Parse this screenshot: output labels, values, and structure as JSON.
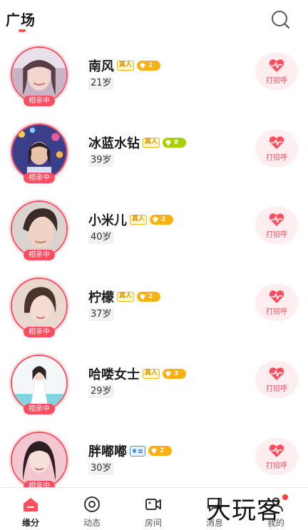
{
  "header": {
    "title": "广场",
    "search_icon": "search-icon"
  },
  "colors": {
    "accent": "#ff4d5e",
    "real_badge": "#f5b800",
    "level_orange": "#f9b111",
    "level_green": "#a6d300"
  },
  "users": [
    {
      "name": "南风",
      "age": "21岁",
      "status": "相亲中",
      "badge": "真人",
      "level": "2",
      "level_color": "orange",
      "greet_label": "打招呼"
    },
    {
      "name": "冰蓝水钻",
      "age": "39岁",
      "status": "相亲中",
      "badge": "真人",
      "level": "8",
      "level_color": "green",
      "greet_label": "打招呼"
    },
    {
      "name": "小米儿",
      "age": "40岁",
      "status": "相亲中",
      "badge": "真人",
      "level": "2",
      "level_color": "orange",
      "greet_label": "打招呼"
    },
    {
      "name": "柠檬",
      "age": "37岁",
      "status": "相亲中",
      "badge": "真人",
      "level": "2",
      "level_color": "orange",
      "greet_label": "打招呼"
    },
    {
      "name": "哈喽女士",
      "age": "29岁",
      "status": "相亲中",
      "badge": "真人",
      "level": "3",
      "level_color": "orange",
      "greet_label": "打招呼"
    },
    {
      "name": "胖嘟嘟",
      "age": "30岁",
      "status": "相亲中",
      "badge": "id-card",
      "level": "2",
      "level_color": "orange",
      "greet_label": "打招呼"
    }
  ],
  "tabbar": {
    "tabs": [
      {
        "label": "缘分",
        "icon": "home-icon",
        "active": true
      },
      {
        "label": "动态",
        "icon": "target-icon",
        "active": false
      },
      {
        "label": "房间",
        "icon": "video-camera-icon",
        "active": false
      },
      {
        "label": "消息",
        "icon": "message-icon",
        "active": false
      },
      {
        "label": "我的",
        "icon": "profile-icon",
        "active": false
      }
    ]
  },
  "watermark": "大玩客"
}
